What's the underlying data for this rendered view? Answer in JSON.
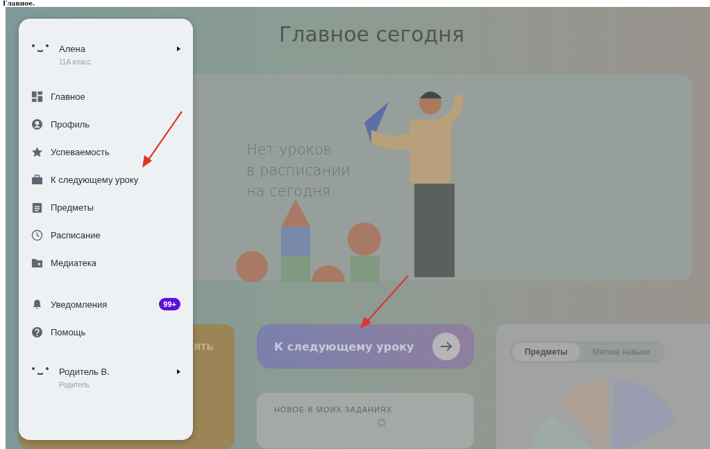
{
  "doc_heading": "Главное.",
  "page": {
    "title": "Главное сегодня",
    "empty_message": "Нет уроков\nв расписании\nна сегодня"
  },
  "next_lesson_button": {
    "label": "К следующему уроку"
  },
  "promo_card": {
    "title_fragment": "ять"
  },
  "tasks_card": {
    "title": "НОВОЕ В МОИХ ЗАДАНИЯХ"
  },
  "stats_card": {
    "tabs": [
      {
        "label": "Предметы",
        "selected": true
      },
      {
        "label": "Мягкие навыки",
        "selected": false
      }
    ]
  },
  "menu": {
    "user": {
      "name": "Алена",
      "subtitle": "11А класс"
    },
    "items": [
      {
        "kind": "dashboard",
        "label": "Главное"
      },
      {
        "kind": "profile",
        "label": "Профиль"
      },
      {
        "kind": "star",
        "label": "Успеваемость"
      },
      {
        "kind": "briefcase",
        "label": "К следующему уроку"
      },
      {
        "kind": "clipboard",
        "label": "Предметы"
      },
      {
        "kind": "clock",
        "label": "Расписание"
      },
      {
        "kind": "folder",
        "label": "Медиатека"
      }
    ],
    "secondary_items": [
      {
        "kind": "bell",
        "label": "Уведомления",
        "badge": "99+"
      },
      {
        "kind": "help",
        "label": "Помощь"
      }
    ],
    "parent": {
      "name": "Родитель В.",
      "subtitle": "Родитель"
    }
  }
}
